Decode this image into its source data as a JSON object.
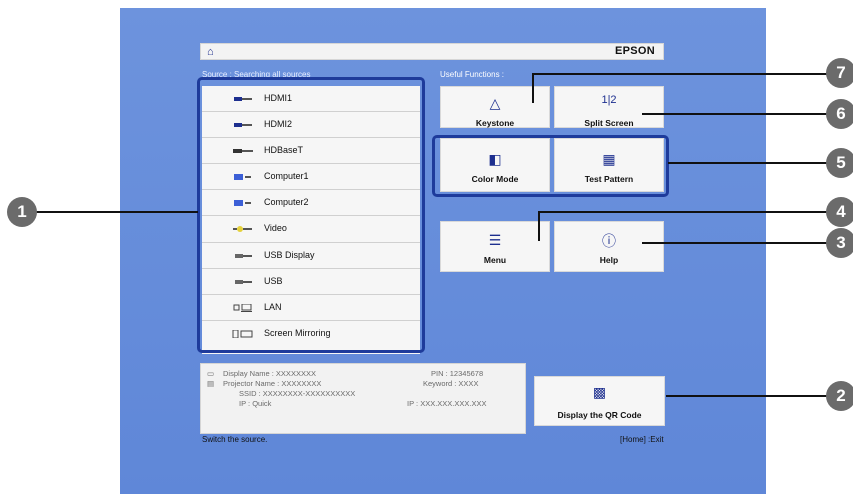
{
  "topbar": {
    "home_icon": "home-icon",
    "brand": "EPSON"
  },
  "source_header": "Source : Searching all sources",
  "useful_header": "Useful Functions :",
  "sources": [
    {
      "label": "HDMI1",
      "icon": "hdmi-icon"
    },
    {
      "label": "HDMI2",
      "icon": "hdmi-icon"
    },
    {
      "label": "HDBaseT",
      "icon": "hdbaset-icon"
    },
    {
      "label": "Computer1",
      "icon": "vga-icon"
    },
    {
      "label": "Computer2",
      "icon": "vga-icon"
    },
    {
      "label": "Video",
      "icon": "video-icon"
    },
    {
      "label": "USB Display",
      "icon": "usb-icon"
    },
    {
      "label": "USB",
      "icon": "usb-icon"
    },
    {
      "label": "LAN",
      "icon": "lan-icon"
    },
    {
      "label": "Screen Mirroring",
      "icon": "mirroring-icon"
    }
  ],
  "functions": {
    "keystone": "Keystone",
    "split_screen": "Split Screen",
    "color_mode": "Color Mode",
    "test_pattern": "Test Pattern",
    "menu": "Menu",
    "help": "Help",
    "qr": "Display the QR Code"
  },
  "info": {
    "display_name": "Display Name : XXXXXXXX",
    "projector_name": "Projector Name : XXXXXXXX",
    "ssid": "SSID : XXXXXXXX-XXXXXXXXXX",
    "ip_quick": "IP : Quick",
    "pin": "PIN : 12345678",
    "keyword": "Keyword : XXXX",
    "ip_address": "IP : XXX.XXX.XXX.XXX"
  },
  "status": {
    "hint": "Switch the source.",
    "exit": "[Home] :Exit"
  },
  "callouts": [
    "1",
    "2",
    "3",
    "4",
    "5",
    "6",
    "7"
  ]
}
